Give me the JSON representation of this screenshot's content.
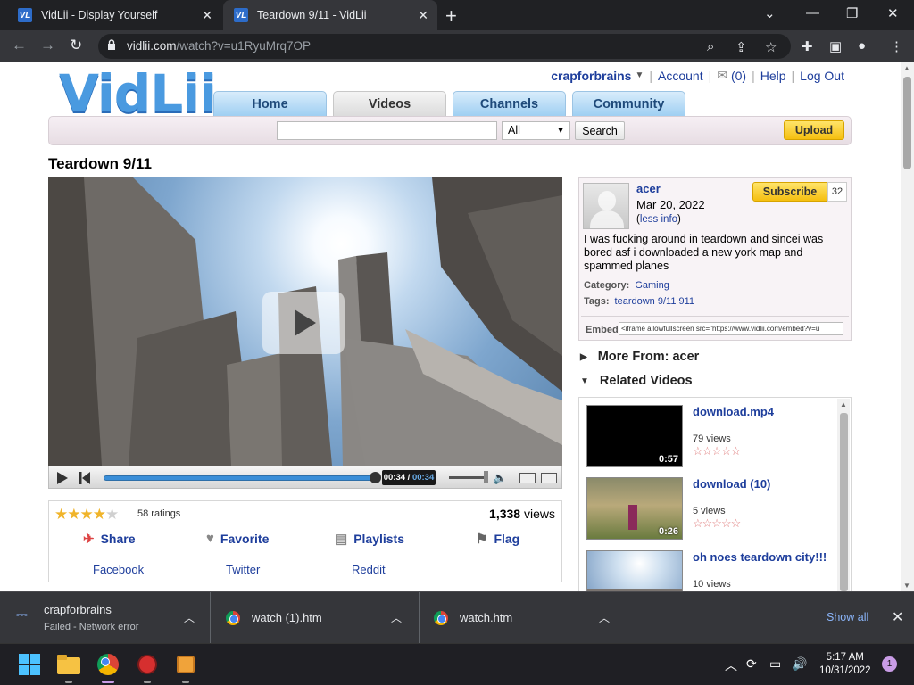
{
  "browser": {
    "tabs": [
      {
        "title": "VidLii - Display Yourself",
        "active": false
      },
      {
        "title": "Teardown 9/11 - VidLii",
        "active": true
      }
    ],
    "url_host": "vidlii.com",
    "url_path": "/watch?v=u1RyuMrq7OP"
  },
  "site": {
    "logo": "VidLii",
    "user": {
      "username": "crapforbrains",
      "account": "Account",
      "inbox_count": "(0)",
      "help": "Help",
      "logout": "Log Out"
    },
    "nav": [
      {
        "label": "Home",
        "current": false
      },
      {
        "label": "Videos",
        "current": true
      },
      {
        "label": "Channels",
        "current": false
      },
      {
        "label": "Community",
        "current": false
      }
    ],
    "search": {
      "placeholder": "",
      "category": "All",
      "button": "Search"
    },
    "upload_label": "Upload"
  },
  "video": {
    "title": "Teardown 9/11",
    "time_current": "00:34",
    "time_total": "00:34",
    "progress": 1.0,
    "volume": 0.9,
    "rating_stars": 4.5,
    "ratings": "58 ratings",
    "views_count": "1,338",
    "views_label": "views",
    "actions": {
      "share": "Share",
      "favorite": "Favorite",
      "playlists": "Playlists",
      "flag": "Flag"
    },
    "share_links": [
      "Facebook",
      "Twitter",
      "Reddit"
    ]
  },
  "channel": {
    "uploader": "acer",
    "date": "Mar 20, 2022",
    "less_info": "less info",
    "subscribe": "Subscribe",
    "subscriber_count": "32",
    "description": "I was fucking around in teardown and sincei was bored asf i downloaded a new york map and spammed planes",
    "category_label": "Category:",
    "category": "Gaming",
    "tags_label": "Tags:",
    "tags": "teardown 9/11 911",
    "embed_label": "Embed",
    "embed_code": "<iframe allowfullscreen src=\"https://www.vidlii.com/embed?v=u"
  },
  "sections": {
    "more_from": "More From: acer",
    "related": "Related Videos"
  },
  "related": [
    {
      "title": "download.mp4",
      "views": "79 views",
      "duration": "0:57"
    },
    {
      "title": "download (10)",
      "views": "5 views",
      "duration": "0:26"
    },
    {
      "title": "oh noes teardown city!!!",
      "views": "10 views",
      "duration": ""
    }
  ],
  "downloads": [
    {
      "name": "crapforbrains",
      "status": "Failed - Network error"
    },
    {
      "name": "watch (1).htm",
      "status": ""
    },
    {
      "name": "watch.htm",
      "status": ""
    }
  ],
  "downloads_show_all": "Show all",
  "taskbar": {
    "time": "5:17 AM",
    "date": "10/31/2022",
    "notifications": "1"
  }
}
